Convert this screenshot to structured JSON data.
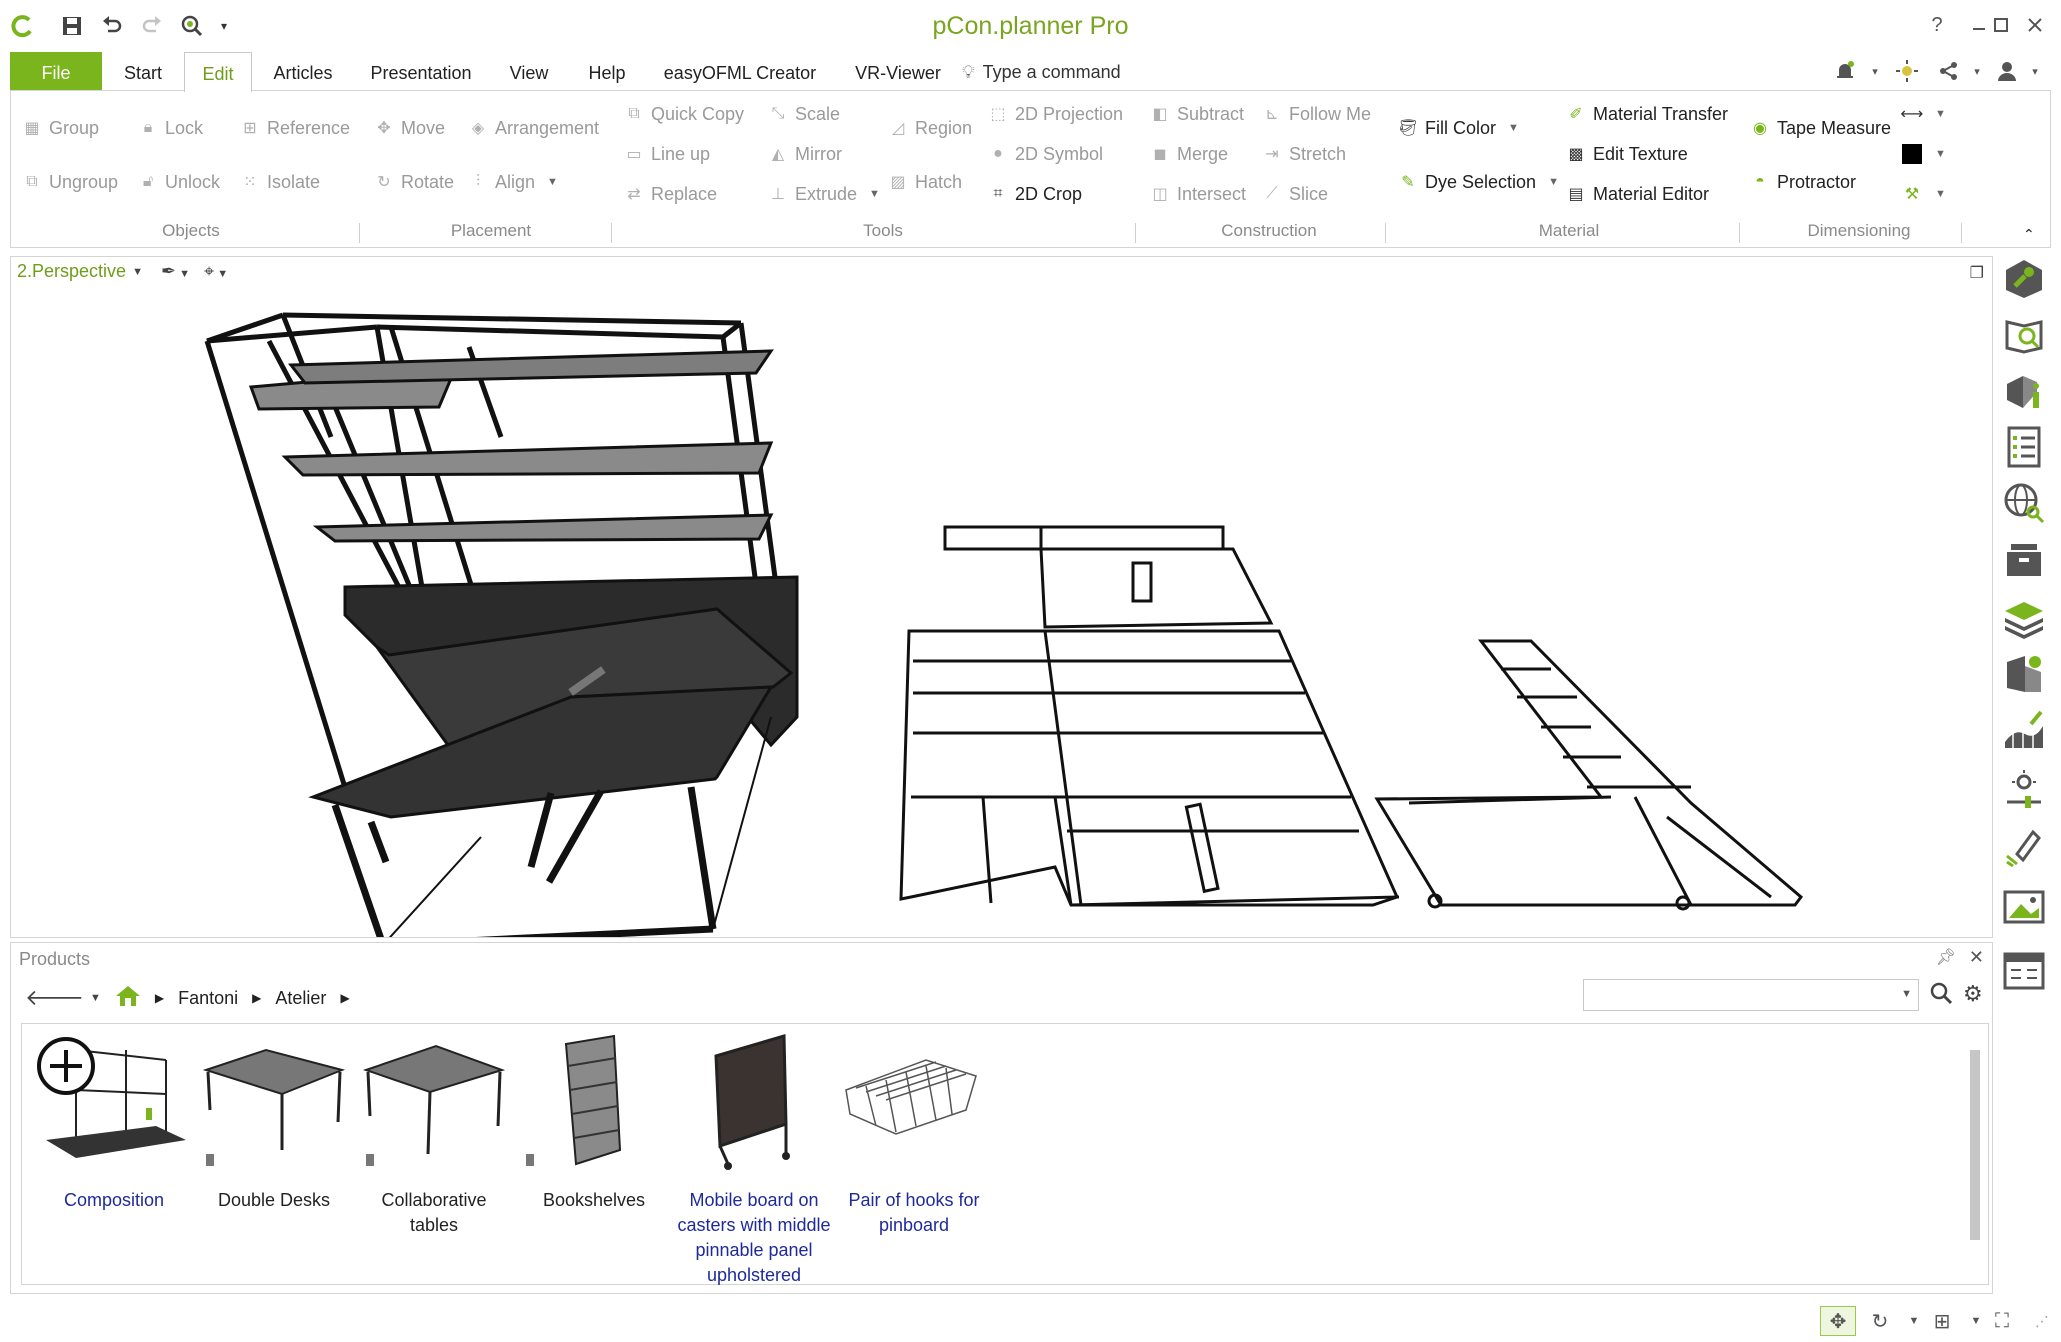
{
  "app": {
    "title": "pCon.planner Pro",
    "accent": "#7ab51d"
  },
  "quick_access": {
    "icons": [
      "pcon-logo-icon",
      "save-icon",
      "undo-icon",
      "redo-icon",
      "search-scene-icon",
      "customize-dropdown-icon"
    ]
  },
  "window_controls": {
    "help": "?",
    "minimize": "minimize-icon",
    "maximize": "maximize-icon",
    "close": "close-icon"
  },
  "menu": {
    "tabs": [
      "File",
      "Start",
      "Edit",
      "Articles",
      "Presentation",
      "View",
      "Help",
      "easyOFML Creator",
      "VR-Viewer"
    ],
    "active_tab": "Edit",
    "command_placeholder": "Type a command"
  },
  "ribbon": {
    "groups": {
      "objects": "Objects",
      "placement": "Placement",
      "tools": "Tools",
      "construction": "Construction",
      "material": "Material",
      "dimensioning": "Dimensioning"
    },
    "objects": {
      "group": "Group",
      "lock": "Lock",
      "ungroup": "Ungroup",
      "unlock": "Unlock"
    },
    "placement": {
      "reference": "Reference",
      "move": "Move",
      "arrangement": "Arrangement",
      "isolate": "Isolate",
      "rotate": "Rotate",
      "align": "Align"
    },
    "tools": {
      "quick_copy": "Quick Copy",
      "scale": "Scale",
      "region": "Region",
      "line_up": "Line up",
      "mirror": "Mirror",
      "hatch": "Hatch",
      "replace": "Replace",
      "extrude": "Extrude",
      "projection": "2D Projection",
      "symbol": "2D Symbol",
      "crop": "2D Crop"
    },
    "construction": {
      "subtract": "Subtract",
      "follow_me": "Follow Me",
      "merge": "Merge",
      "stretch": "Stretch",
      "intersect": "Intersect",
      "slice": "Slice"
    },
    "material": {
      "fill_color": "Fill Color",
      "dye_selection": "Dye Selection",
      "material_transfer": "Material Transfer",
      "edit_texture": "Edit Texture",
      "material_editor": "Material Editor"
    },
    "dimensioning": {
      "tape_measure": "Tape Measure",
      "protractor": "Protractor"
    }
  },
  "viewport": {
    "title": "2.Perspective"
  },
  "sidebar": {
    "icons": [
      "wrench-settings-icon",
      "catalog-search-icon",
      "article-info-icon",
      "list-icon",
      "web-search-icon",
      "archive-box-icon",
      "layers-icon",
      "material-settings-icon",
      "terrain-edit-icon",
      "light-settings-icon",
      "drawing-pen-icon",
      "image-icon",
      "layout-view-icon"
    ]
  },
  "products": {
    "header": "Products",
    "breadcrumb": [
      "Fantoni",
      "Atelier"
    ],
    "search_placeholder": "",
    "items": [
      {
        "label": "Composition",
        "link": true
      },
      {
        "label": "Double Desks",
        "link": false
      },
      {
        "label": "Collaborative tables",
        "link": false
      },
      {
        "label": "Bookshelves",
        "link": false
      },
      {
        "label": "Mobile board on casters with middle pinnable panel upholstered",
        "link": true
      },
      {
        "label": "Pair of hooks for pinboard",
        "link": true
      }
    ]
  }
}
